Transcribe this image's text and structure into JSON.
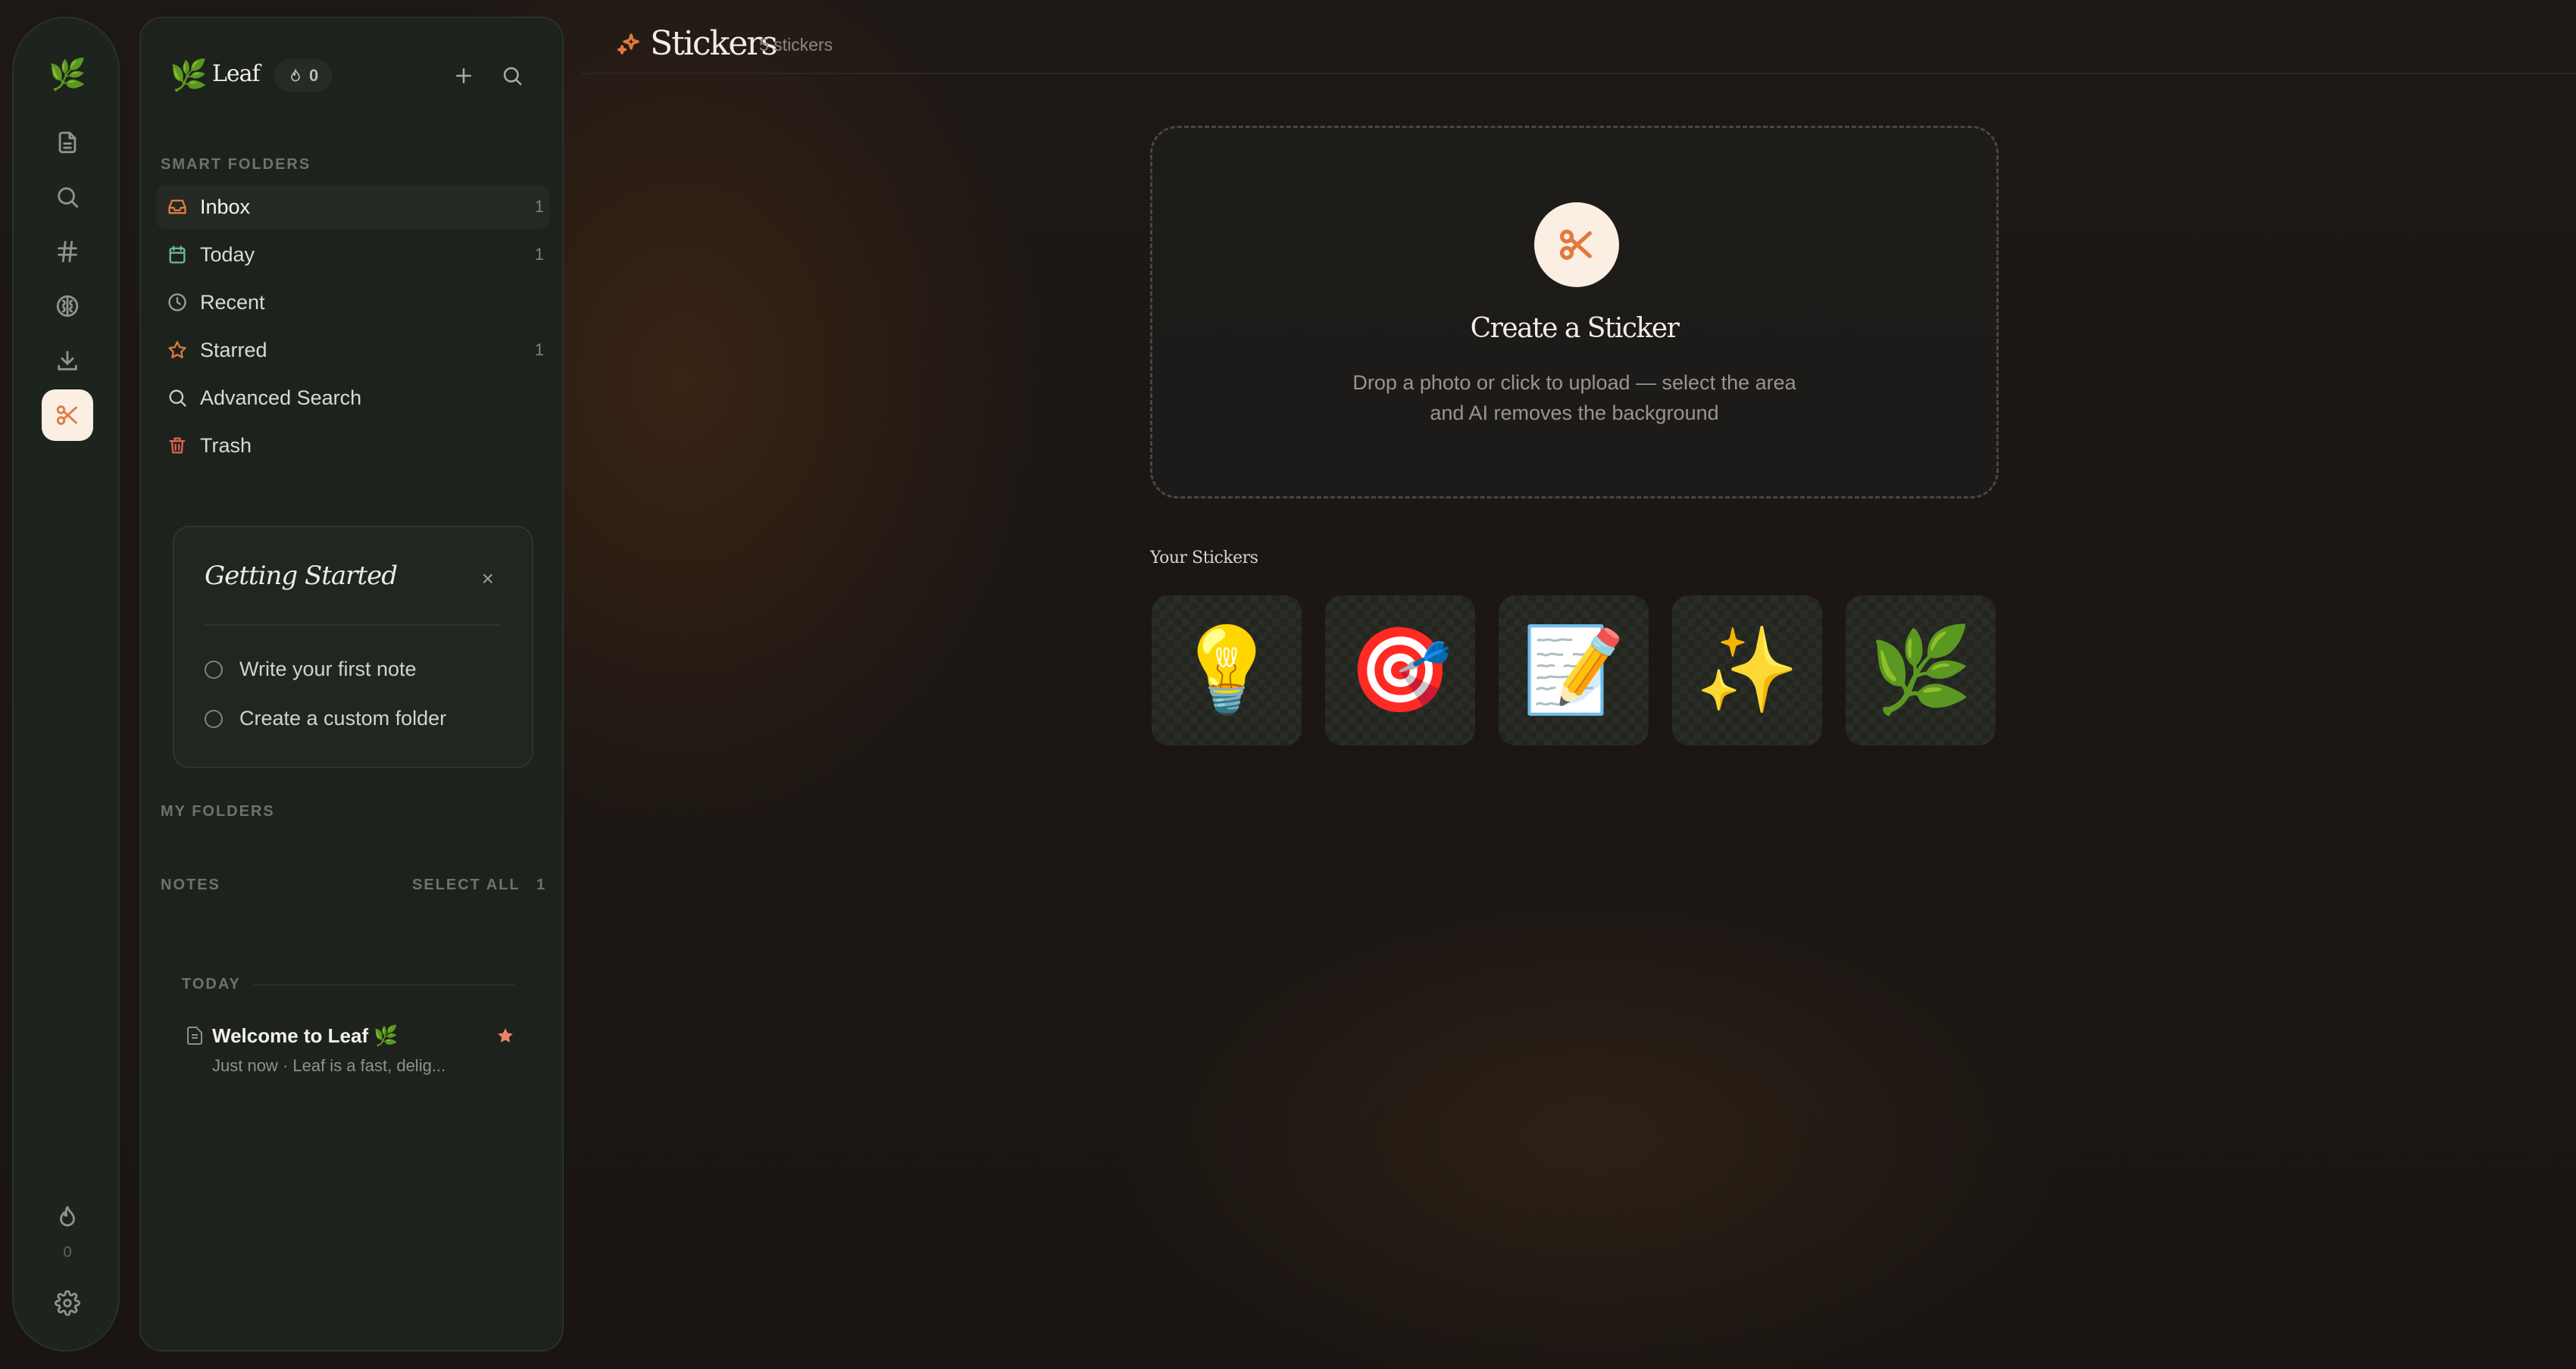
{
  "app": {
    "name": "Leaf",
    "logo_emoji": "🌿",
    "streak_count": "0",
    "accent_color": "#e07a3f"
  },
  "rail": {
    "items": [
      {
        "icon": "notes-icon",
        "label": "Notes"
      },
      {
        "icon": "search-icon",
        "label": "Search"
      },
      {
        "icon": "hashtag-icon",
        "label": "Tags"
      },
      {
        "icon": "brain-icon",
        "label": "AI"
      },
      {
        "icon": "download-icon",
        "label": "Import"
      },
      {
        "icon": "scissors-icon",
        "label": "Stickers",
        "active": true
      }
    ],
    "streak_count": "0",
    "settings_icon": "gear-icon"
  },
  "sidebar": {
    "smart_folders_label": "SMART FOLDERS",
    "smart_folders": [
      {
        "label": "Inbox",
        "count": "1",
        "icon": "inbox-icon",
        "color": "#e07a3f",
        "active": true
      },
      {
        "label": "Today",
        "count": "1",
        "icon": "calendar-icon",
        "color": "#6fb98f"
      },
      {
        "label": "Recent",
        "count": "",
        "icon": "clock-icon",
        "color": "#9aa093"
      },
      {
        "label": "Starred",
        "count": "1",
        "icon": "star-icon",
        "color": "#e07a3f"
      },
      {
        "label": "Advanced Search",
        "count": "",
        "icon": "search-icon",
        "color": "#c9cbc2"
      },
      {
        "label": "Trash",
        "count": "",
        "icon": "trash-icon",
        "color": "#e0604f"
      }
    ],
    "getting_started": {
      "title": "Getting Started",
      "close": "×",
      "tasks": [
        "Write your first note",
        "Create a custom folder"
      ]
    },
    "my_folders_label": "MY FOLDERS",
    "notes_label": "NOTES",
    "select_all_label": "SELECT ALL",
    "notes_count": "1",
    "date_group": "TODAY",
    "notes": [
      {
        "title": "Welcome to Leaf 🌿",
        "subtitle": "Just now · Leaf is a fast, delig...",
        "starred": true
      }
    ]
  },
  "main": {
    "title": "Stickers",
    "subtitle": "5 stickers",
    "create": {
      "title": "Create a Sticker",
      "description": "Drop a photo or click to upload — select the area and AI removes the background"
    },
    "your_stickers_label": "Your Stickers",
    "stickers": [
      "💡",
      "🎯",
      "📝",
      "✨",
      "🌿"
    ]
  }
}
